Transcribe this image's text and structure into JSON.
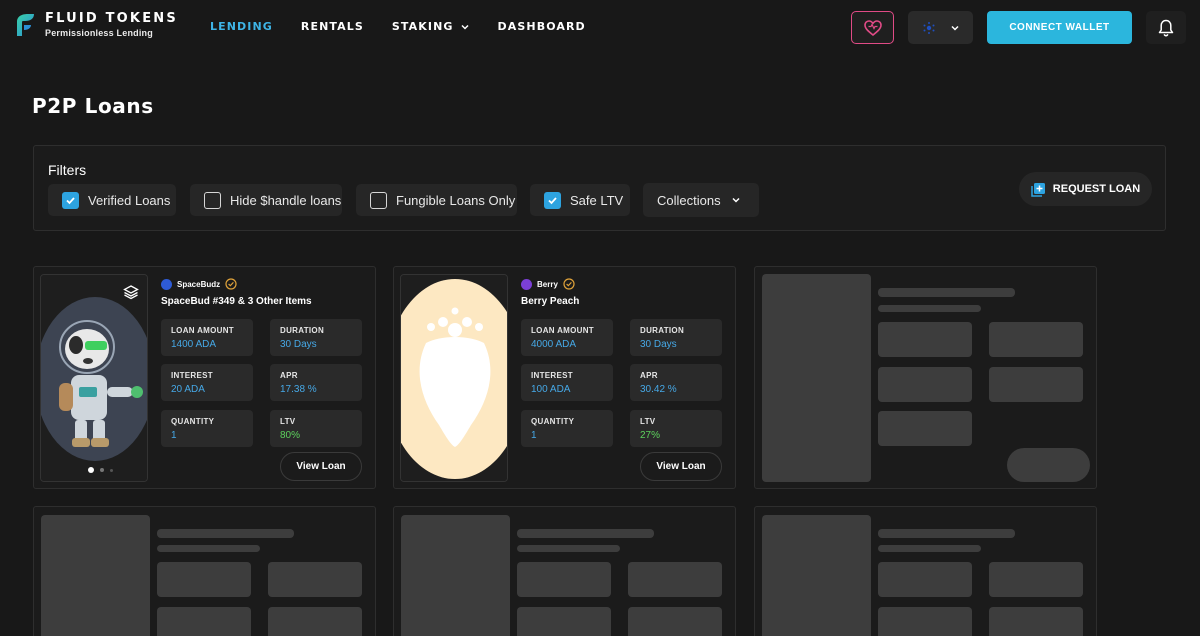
{
  "brand": {
    "name": "FLUID TOKENS",
    "tagline": "Permissionless Lending"
  },
  "nav": [
    {
      "label": "LENDING",
      "active": true
    },
    {
      "label": "RENTALS",
      "active": false
    },
    {
      "label": "STAKING",
      "active": false,
      "dropdown": true
    },
    {
      "label": "DASHBOARD",
      "active": false
    }
  ],
  "header": {
    "connect_label": "CONNECT WALLET",
    "heart_icon": "heart-icon",
    "network_icon": "cardano-icon",
    "bell_icon": "bell-icon"
  },
  "page": {
    "title": "P2P Loans"
  },
  "filters": {
    "title": "Filters",
    "chips": [
      {
        "label": "Verified Loans",
        "checked": true
      },
      {
        "label": "Hide $handle loans",
        "checked": false
      },
      {
        "label": "Fungible Loans Only",
        "checked": false
      },
      {
        "label": "Safe LTV",
        "checked": true
      }
    ],
    "collections_label": "Collections",
    "request_label": "REQUEST LOAN"
  },
  "cards": [
    {
      "collection": "SpaceBudz",
      "title": "SpaceBud #349 & 3 Other Items",
      "stats": [
        {
          "label": "LOAN AMOUNT",
          "value": "1400 ADA"
        },
        {
          "label": "DURATION",
          "value": "30 Days"
        },
        {
          "label": "INTEREST",
          "value": "20 ADA"
        },
        {
          "label": "APR",
          "value": "17.38 %"
        },
        {
          "label": "QUANTITY",
          "value": "1"
        },
        {
          "label": "LTV",
          "value": "80%"
        }
      ],
      "button": "View Loan"
    },
    {
      "collection": "Berry",
      "title": "Berry Peach",
      "stats": [
        {
          "label": "LOAN AMOUNT",
          "value": "4000 ADA"
        },
        {
          "label": "DURATION",
          "value": "30 Days"
        },
        {
          "label": "INTEREST",
          "value": "100 ADA"
        },
        {
          "label": "APR",
          "value": "30.42 %"
        },
        {
          "label": "QUANTITY",
          "value": "1"
        },
        {
          "label": "LTV",
          "value": "27%"
        }
      ],
      "button": "View Loan"
    }
  ],
  "colors": {
    "accent": "#3eb4e6",
    "connect": "#2bb6dd",
    "value_blue": "#46a8e6",
    "ltv_green": "#5dd15d",
    "heart": "#e04b86"
  }
}
